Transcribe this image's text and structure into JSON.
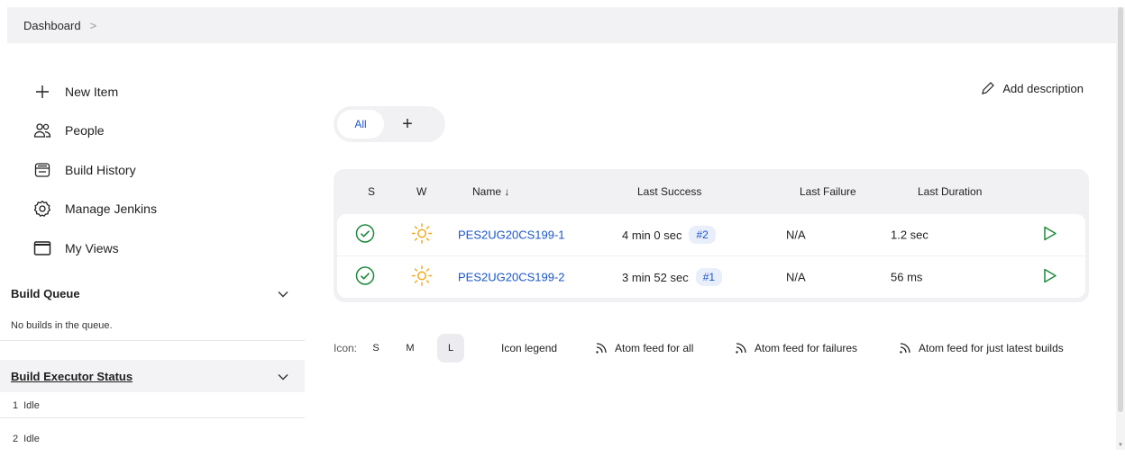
{
  "breadcrumb": {
    "dashboard": "Dashboard",
    "separator": ">"
  },
  "tasks": [
    {
      "label": "New Item",
      "icon": "plus-icon"
    },
    {
      "label": "People",
      "icon": "people-icon"
    },
    {
      "label": "Build History",
      "icon": "build-history-icon"
    },
    {
      "label": "Manage Jenkins",
      "icon": "gear-icon"
    },
    {
      "label": "My Views",
      "icon": "window-icon"
    }
  ],
  "build_queue": {
    "title": "Build Queue",
    "empty_text": "No builds in the queue."
  },
  "executors": {
    "title": "Build Executor Status",
    "items": [
      {
        "num": "1",
        "status": "Idle"
      },
      {
        "num": "2",
        "status": "Idle"
      }
    ]
  },
  "add_description": "Add description",
  "tabs": {
    "all": "All",
    "add": "+"
  },
  "table": {
    "headers": {
      "s": "S",
      "w": "W",
      "name": "Name ↓",
      "last_success": "Last Success",
      "last_failure": "Last Failure",
      "last_duration": "Last Duration"
    },
    "rows": [
      {
        "name": "PES2UG20CS199-1",
        "last_success": "4 min 0 sec",
        "build": "#2",
        "last_failure": "N/A",
        "last_duration": "1.2 sec"
      },
      {
        "name": "PES2UG20CS199-2",
        "last_success": "3 min 52 sec",
        "build": "#1",
        "last_failure": "N/A",
        "last_duration": "56 ms"
      }
    ]
  },
  "footer": {
    "icon_label": "Icon:",
    "sizes": {
      "s": "S",
      "m": "M",
      "l": "L"
    },
    "legend": "Icon legend",
    "feed_all": "Atom feed for all",
    "feed_failures": "Atom feed for failures",
    "feed_latest": "Atom feed for just latest builds"
  },
  "colors": {
    "link": "#1a56c8",
    "success": "#1e8a3c",
    "weather": "#f0a81c",
    "build_button": "#1e8a3c"
  }
}
